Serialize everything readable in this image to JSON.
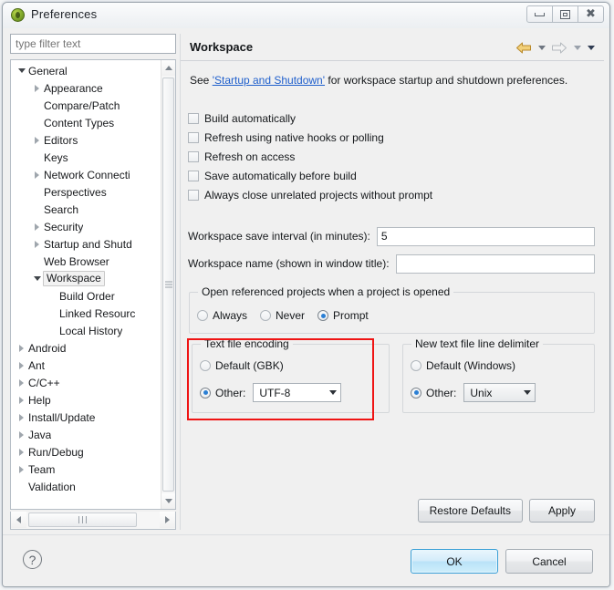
{
  "window": {
    "title": "Preferences",
    "icon": "eclipse-icon",
    "controls": {
      "minimize": "minimize-icon",
      "maximize": "maximize-icon",
      "close": "close-icon"
    }
  },
  "sidebar": {
    "filter_placeholder": "type filter text",
    "filter_value": "",
    "selected": "Workspace",
    "items": [
      {
        "label": "General",
        "indent": 0,
        "twisty": "down"
      },
      {
        "label": "Appearance",
        "indent": 1,
        "twisty": "right"
      },
      {
        "label": "Compare/Patch",
        "indent": 1,
        "twisty": "none"
      },
      {
        "label": "Content Types",
        "indent": 1,
        "twisty": "none"
      },
      {
        "label": "Editors",
        "indent": 1,
        "twisty": "right"
      },
      {
        "label": "Keys",
        "indent": 1,
        "twisty": "none"
      },
      {
        "label": "Network Connecti",
        "indent": 1,
        "twisty": "right"
      },
      {
        "label": "Perspectives",
        "indent": 1,
        "twisty": "none"
      },
      {
        "label": "Search",
        "indent": 1,
        "twisty": "none"
      },
      {
        "label": "Security",
        "indent": 1,
        "twisty": "right"
      },
      {
        "label": "Startup and Shutd",
        "indent": 1,
        "twisty": "right"
      },
      {
        "label": "Web Browser",
        "indent": 1,
        "twisty": "none"
      },
      {
        "label": "Workspace",
        "indent": 1,
        "twisty": "down"
      },
      {
        "label": "Build Order",
        "indent": 2,
        "twisty": "none"
      },
      {
        "label": "Linked Resourc",
        "indent": 2,
        "twisty": "none"
      },
      {
        "label": "Local History",
        "indent": 2,
        "twisty": "none"
      },
      {
        "label": "Android",
        "indent": 0,
        "twisty": "right"
      },
      {
        "label": "Ant",
        "indent": 0,
        "twisty": "right"
      },
      {
        "label": "C/C++",
        "indent": 0,
        "twisty": "right"
      },
      {
        "label": "Help",
        "indent": 0,
        "twisty": "right"
      },
      {
        "label": "Install/Update",
        "indent": 0,
        "twisty": "right"
      },
      {
        "label": "Java",
        "indent": 0,
        "twisty": "right"
      },
      {
        "label": "Run/Debug",
        "indent": 0,
        "twisty": "right"
      },
      {
        "label": "Team",
        "indent": 0,
        "twisty": "right"
      },
      {
        "label": "Validation",
        "indent": 0,
        "twisty": "none"
      }
    ]
  },
  "page": {
    "title": "Workspace",
    "nav": {
      "back": "back-arrow-icon",
      "back_menu": "chevron-down-icon",
      "forward": "forward-arrow-icon",
      "forward_menu": "chevron-down-icon",
      "view_menu": "chevron-down-icon"
    },
    "hint_before": "See ",
    "hint_link": "'Startup and Shutdown'",
    "hint_after": " for workspace startup and shutdown preferences.",
    "checkboxes": [
      {
        "label": "Build automatically",
        "checked": false
      },
      {
        "label": "Refresh using native hooks or polling",
        "checked": false
      },
      {
        "label": "Refresh on access",
        "checked": false
      },
      {
        "label": "Save automatically before build",
        "checked": false
      },
      {
        "label": "Always close unrelated projects without prompt",
        "checked": false
      }
    ],
    "save_interval": {
      "label": "Workspace save interval (in minutes):",
      "value": "5"
    },
    "workspace_name": {
      "label": "Workspace name (shown in window title):",
      "value": "",
      "placeholder": ""
    },
    "open_referenced": {
      "legend": "Open referenced projects when a project is opened",
      "options": [
        "Always",
        "Never",
        "Prompt"
      ],
      "selected": "Prompt"
    },
    "text_file_encoding": {
      "legend": "Text file encoding",
      "default_label": "Default (GBK)",
      "other_label": "Other:",
      "selected": "other",
      "value": "UTF-8",
      "highlighted": true,
      "highlight_color": "#ef1414"
    },
    "line_delimiter": {
      "legend": "New text file line delimiter",
      "default_label": "Default (Windows)",
      "other_label": "Other:",
      "selected": "other",
      "value": "Unix"
    },
    "restore_defaults_label": "Restore Defaults",
    "apply_label": "Apply"
  },
  "footer": {
    "help": "help-icon",
    "ok_label": "OK",
    "cancel_label": "Cancel"
  }
}
